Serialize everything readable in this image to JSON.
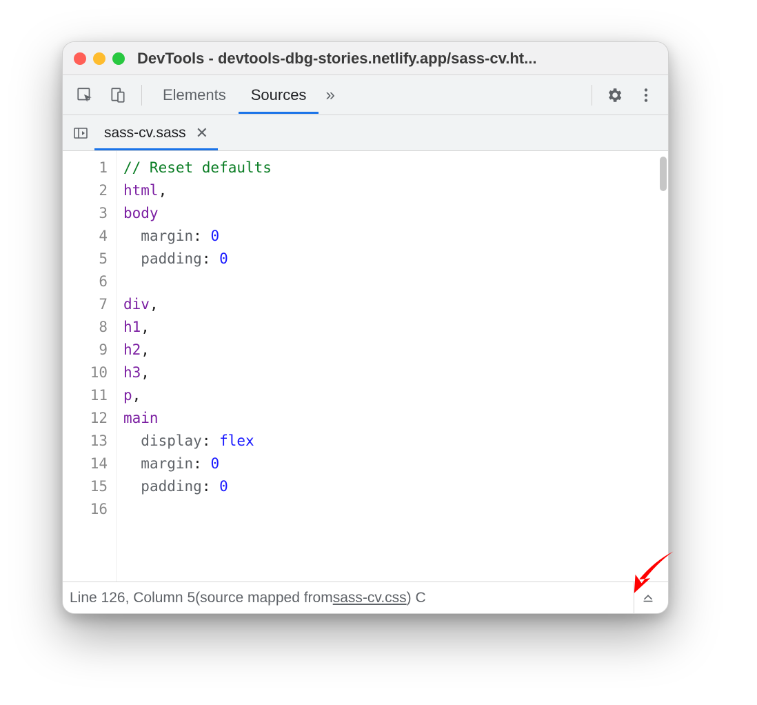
{
  "window": {
    "title": "DevTools - devtools-dbg-stories.netlify.app/sass-cv.ht..."
  },
  "toolbar": {
    "tabs": [
      {
        "label": "Elements",
        "active": false
      },
      {
        "label": "Sources",
        "active": true
      }
    ]
  },
  "filebar": {
    "filename": "sass-cv.sass"
  },
  "code": {
    "lines": [
      {
        "n": "1",
        "tokens": [
          {
            "t": "// Reset defaults",
            "c": "tok-comment"
          }
        ]
      },
      {
        "n": "2",
        "tokens": [
          {
            "t": "html",
            "c": "tok-sel"
          },
          {
            "t": ",",
            "c": "tok-punc"
          }
        ]
      },
      {
        "n": "3",
        "tokens": [
          {
            "t": "body",
            "c": "tok-sel"
          }
        ]
      },
      {
        "n": "4",
        "tokens": [
          {
            "t": "  ",
            "c": ""
          },
          {
            "t": "margin",
            "c": "tok-prop"
          },
          {
            "t": ": ",
            "c": "tok-punc"
          },
          {
            "t": "0",
            "c": "tok-num"
          }
        ]
      },
      {
        "n": "5",
        "tokens": [
          {
            "t": "  ",
            "c": ""
          },
          {
            "t": "padding",
            "c": "tok-prop"
          },
          {
            "t": ": ",
            "c": "tok-punc"
          },
          {
            "t": "0",
            "c": "tok-num"
          }
        ]
      },
      {
        "n": "6",
        "tokens": [
          {
            "t": "",
            "c": ""
          }
        ]
      },
      {
        "n": "7",
        "tokens": [
          {
            "t": "div",
            "c": "tok-sel"
          },
          {
            "t": ",",
            "c": "tok-punc"
          }
        ]
      },
      {
        "n": "8",
        "tokens": [
          {
            "t": "h1",
            "c": "tok-sel"
          },
          {
            "t": ",",
            "c": "tok-punc"
          }
        ]
      },
      {
        "n": "9",
        "tokens": [
          {
            "t": "h2",
            "c": "tok-sel"
          },
          {
            "t": ",",
            "c": "tok-punc"
          }
        ]
      },
      {
        "n": "10",
        "tokens": [
          {
            "t": "h3",
            "c": "tok-sel"
          },
          {
            "t": ",",
            "c": "tok-punc"
          }
        ]
      },
      {
        "n": "11",
        "tokens": [
          {
            "t": "p",
            "c": "tok-sel"
          },
          {
            "t": ",",
            "c": "tok-punc"
          }
        ]
      },
      {
        "n": "12",
        "tokens": [
          {
            "t": "main",
            "c": "tok-sel"
          }
        ]
      },
      {
        "n": "13",
        "tokens": [
          {
            "t": "  ",
            "c": ""
          },
          {
            "t": "display",
            "c": "tok-prop"
          },
          {
            "t": ": ",
            "c": "tok-punc"
          },
          {
            "t": "flex",
            "c": "tok-val"
          }
        ]
      },
      {
        "n": "14",
        "tokens": [
          {
            "t": "  ",
            "c": ""
          },
          {
            "t": "margin",
            "c": "tok-prop"
          },
          {
            "t": ": ",
            "c": "tok-punc"
          },
          {
            "t": "0",
            "c": "tok-num"
          }
        ]
      },
      {
        "n": "15",
        "tokens": [
          {
            "t": "  ",
            "c": ""
          },
          {
            "t": "padding",
            "c": "tok-prop"
          },
          {
            "t": ": ",
            "c": "tok-punc"
          },
          {
            "t": "0",
            "c": "tok-num"
          }
        ]
      },
      {
        "n": "16",
        "tokens": [
          {
            "t": "",
            "c": ""
          }
        ]
      }
    ]
  },
  "statusbar": {
    "position": "Line 126, Column 5",
    "mapped_prefix": " (source mapped from ",
    "mapped_file": "sass-cv.css",
    "mapped_suffix": ") C"
  }
}
